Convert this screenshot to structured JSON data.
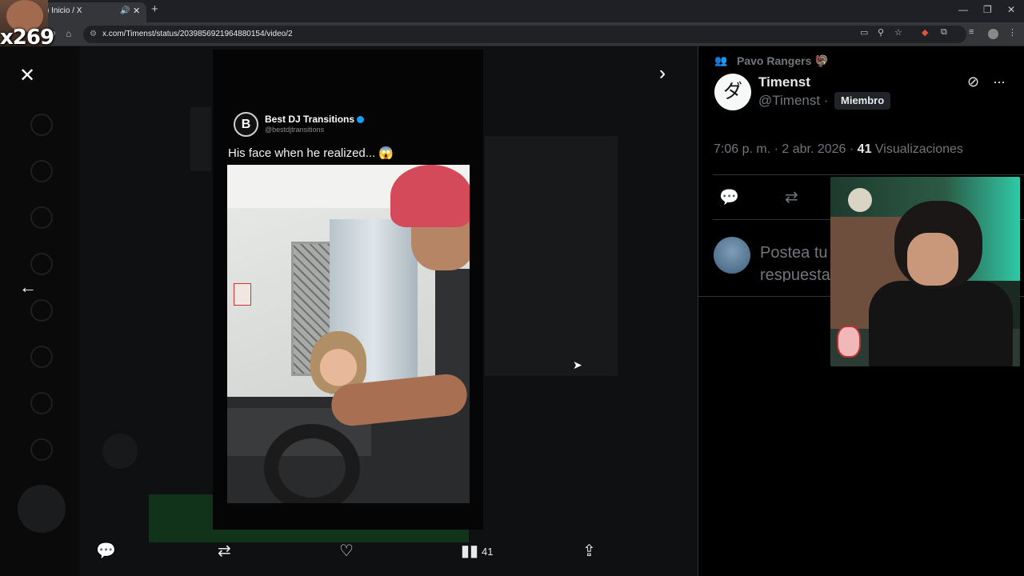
{
  "browser": {
    "tab_title": ") Inicio / X",
    "new_tab_symbol": "+",
    "url": "x.com/Timenst/status/2039856921964880154/video/2"
  },
  "stream_overlay": {
    "label": "x269"
  },
  "media_viewer": {
    "quoted_post": {
      "logo_letter": "B",
      "author_name": "Best DJ Transitions",
      "author_handle": "@bestdjtransitions",
      "text": "His face when he realized... 😱"
    },
    "actions": {
      "views_count": "41"
    }
  },
  "post_panel": {
    "community_name": "Pavo Rangers 🦃",
    "avatar_glyph": "ダ",
    "author_name": "Timenst",
    "author_handle": "@Timenst ·",
    "member_badge": "Miembro",
    "time_text": "7:06 p. m. · 2 abr. 2026 ·",
    "views_number": "41",
    "views_label": "Visualizaciones",
    "reply_placeholder": "Postea tu respuesta"
  },
  "colors": {
    "background": "#000000",
    "accent_blue": "#1d9bf0",
    "muted_text": "#71767b",
    "primary_text": "#e7e9ea"
  },
  "icons": [
    "close-icon",
    "expand-icon",
    "back-arrow-icon",
    "reply-icon",
    "repost-icon",
    "like-icon",
    "views-icon",
    "share-icon",
    "grok-icon",
    "more-icon",
    "community-icon"
  ]
}
